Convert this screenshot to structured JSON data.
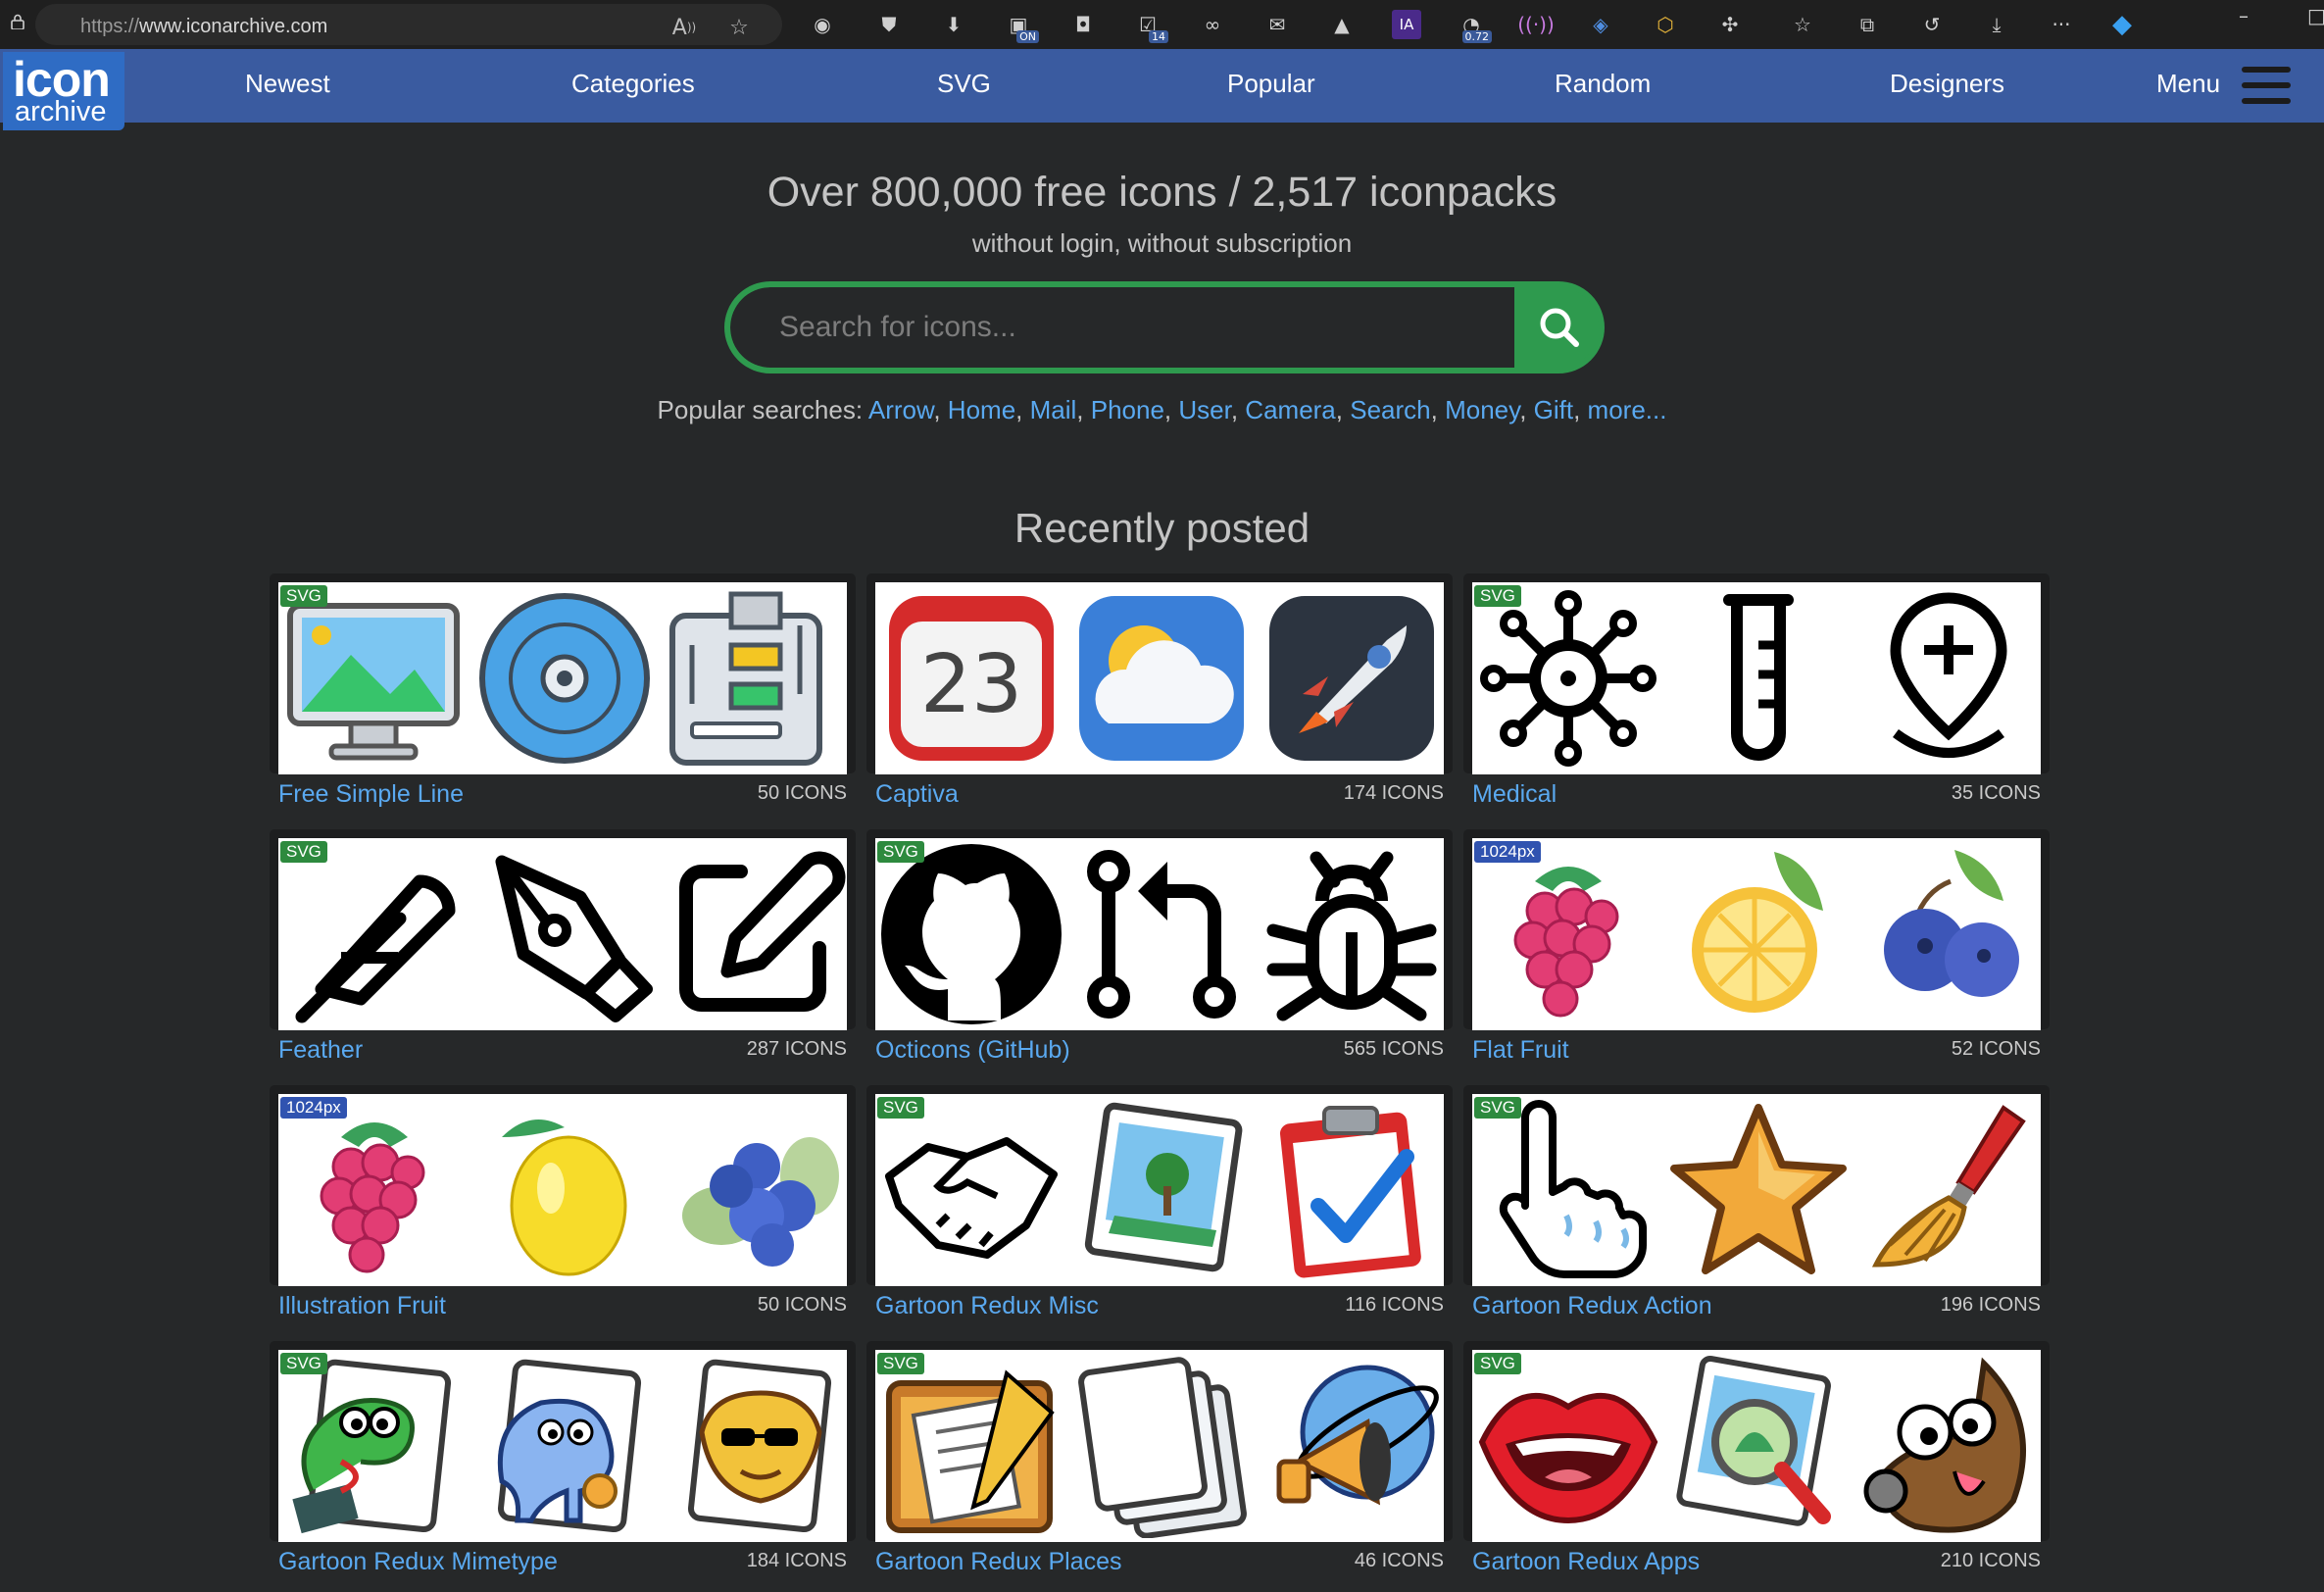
{
  "browser": {
    "url_protocol": "https://",
    "url_host": "www.iconarchive.com",
    "extension_badges": [
      "ON",
      "14",
      "IA",
      "0.72"
    ]
  },
  "logo": {
    "line1": "icon",
    "line2": "archive"
  },
  "nav": {
    "items": [
      "Newest",
      "Categories",
      "SVG",
      "Popular",
      "Random",
      "Designers"
    ],
    "menu_label": "Menu"
  },
  "hero": {
    "title": "Over 800,000 free icons / 2,517 iconpacks",
    "subtitle": "without login, without subscription",
    "search_placeholder": "Search for icons...",
    "popular_label": "Popular searches:",
    "popular_links": [
      "Arrow",
      "Home",
      "Mail",
      "Phone",
      "User",
      "Camera",
      "Search",
      "Money",
      "Gift",
      "more..."
    ]
  },
  "recent": {
    "title": "Recently posted",
    "packs": [
      {
        "name": "Free Simple Line",
        "count": "50 ICONS",
        "badge": "SVG",
        "icons": [
          "monitor-landscape-icon",
          "disc-icon",
          "workflow-icon"
        ]
      },
      {
        "name": "Captiva",
        "count": "174 ICONS",
        "badge": "",
        "icons": [
          "calendar-23-icon",
          "weather-cloud-sun-icon",
          "rocket-icon"
        ]
      },
      {
        "name": "Medical",
        "count": "35 ICONS",
        "badge": "SVG",
        "icons": [
          "virus-icon",
          "test-tube-icon",
          "location-medical-icon"
        ]
      },
      {
        "name": "Feather",
        "count": "287 ICONS",
        "badge": "SVG",
        "icons": [
          "feather-icon",
          "pen-tool-icon",
          "edit-icon"
        ]
      },
      {
        "name": "Octicons (GitHub)",
        "count": "565 ICONS",
        "badge": "SVG",
        "icons": [
          "github-icon",
          "pull-request-icon",
          "bug-icon"
        ]
      },
      {
        "name": "Flat Fruit",
        "count": "52 ICONS",
        "badge": "1024px",
        "icons": [
          "raspberry-icon",
          "lemon-slice-icon",
          "blueberry-icon"
        ]
      },
      {
        "name": "Illustration Fruit",
        "count": "50 ICONS",
        "badge": "1024px",
        "icons": [
          "raspberry-icon",
          "lemon-icon",
          "blueberries-icon"
        ]
      },
      {
        "name": "Gartoon Redux Misc",
        "count": "116 ICONS",
        "badge": "SVG",
        "icons": [
          "handshake-icon",
          "picture-icon",
          "clipboard-check-icon"
        ]
      },
      {
        "name": "Gartoon Redux Action",
        "count": "196 ICONS",
        "badge": "SVG",
        "icons": [
          "pointing-hand-icon",
          "star-icon",
          "broom-icon"
        ]
      },
      {
        "name": "Gartoon Redux Mimetype",
        "count": "184 ICONS",
        "badge": "SVG",
        "icons": [
          "python-file-icon",
          "php-file-icon",
          "perl-file-icon"
        ]
      },
      {
        "name": "Gartoon Redux Places",
        "count": "46 ICONS",
        "badge": "SVG",
        "icons": [
          "notes-folder-icon",
          "documents-icon",
          "network-megaphone-icon"
        ]
      },
      {
        "name": "Gartoon Redux Apps",
        "count": "210 ICONS",
        "badge": "SVG",
        "icons": [
          "lips-icon",
          "image-viewer-icon",
          "gimp-icon"
        ]
      }
    ]
  },
  "colors": {
    "page_bg": "#262829",
    "header_bg": "#3a5ba0",
    "logo_bg": "#2f6cc4",
    "search_green": "#2e9a4e",
    "link_blue": "#5aa9f0",
    "badge_svg": "#2d8a3e",
    "badge_px": "#3053b0"
  }
}
